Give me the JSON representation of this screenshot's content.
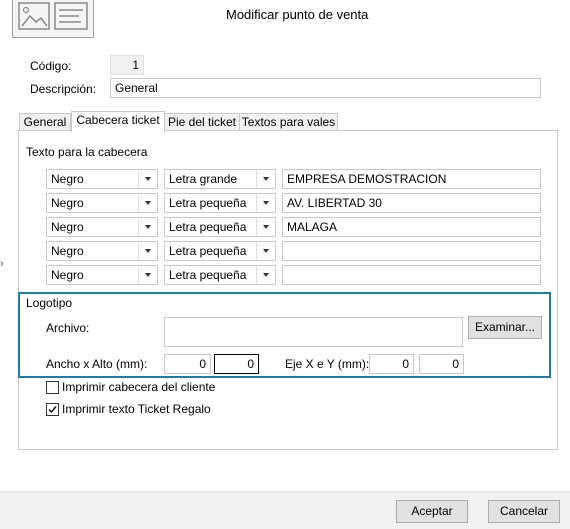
{
  "window": {
    "title": "Modificar punto de venta"
  },
  "fields": {
    "codigo_label": "Código:",
    "codigo_value": "1",
    "descripcion_label": "Descripción:",
    "descripcion_value": "General"
  },
  "tabs": [
    {
      "label": "General"
    },
    {
      "label": "Cabecera ticket"
    },
    {
      "label": "Pie del ticket"
    },
    {
      "label": "Textos para vales"
    }
  ],
  "header_section": {
    "title": "Texto para la cabecera",
    "rows": [
      {
        "color": "Negro",
        "size": "Letra grande",
        "text": "EMPRESA DEMOSTRACION"
      },
      {
        "color": "Negro",
        "size": "Letra pequeña",
        "text": "AV. LIBERTAD 30"
      },
      {
        "color": "Negro",
        "size": "Letra pequeña",
        "text": "MALAGA"
      },
      {
        "color": "Negro",
        "size": "Letra pequeña",
        "text": ""
      },
      {
        "color": "Negro",
        "size": "Letra pequeña",
        "text": ""
      }
    ]
  },
  "logo": {
    "title": "Logotipo",
    "archivo_label": "Archivo:",
    "archivo_value": "",
    "examinar_label": "Examinar...",
    "size_label": "Ancho x Alto (mm):",
    "ancho": "0",
    "alto": "0",
    "pos_label": "Eje X e Y (mm):",
    "eje_x": "0",
    "eje_y": "0"
  },
  "options": {
    "imprimir_cabecera_label": "Imprimir cabecera del cliente",
    "imprimir_cabecera_checked": false,
    "imprimir_regalo_label": "Imprimir texto Ticket Regalo",
    "imprimir_regalo_checked": true
  },
  "footer": {
    "aceptar_label": "Aceptar",
    "cancelar_label": "Cancelar"
  },
  "colors": {
    "accent": "#1a7fa8",
    "footer_bg": "#f0f0f0"
  }
}
